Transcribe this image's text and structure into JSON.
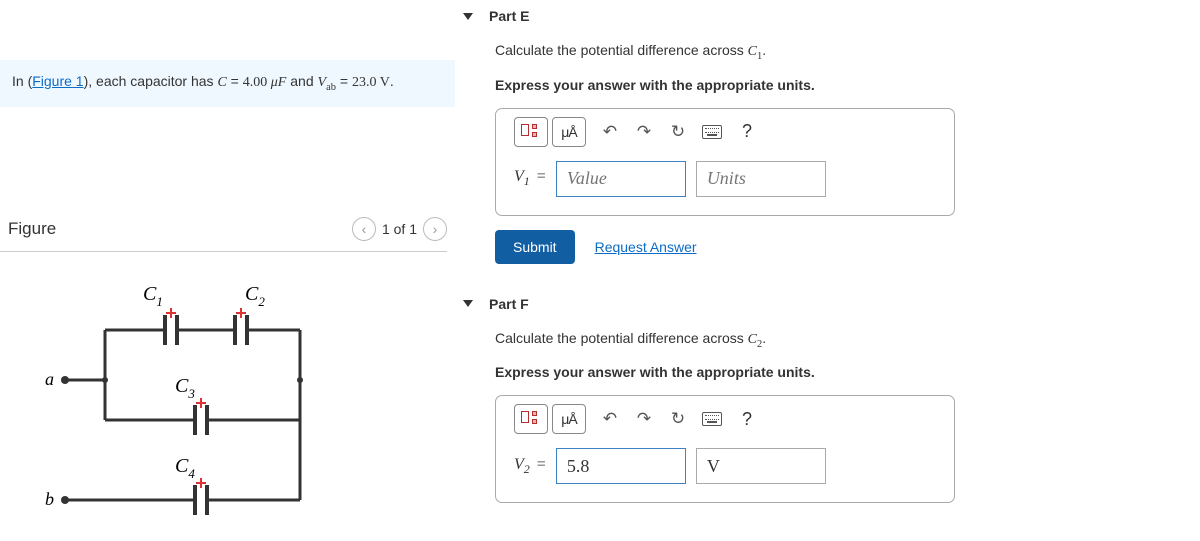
{
  "context": {
    "prefix": "In (",
    "figlink": "Figure 1",
    "mid": "), each capacitor has ",
    "eq1_lhs": "C",
    "eq1_eq": " = ",
    "eq1_val": "4.00 ",
    "eq1_unit": "μF",
    "and": " and ",
    "eq2_lhs_v": "V",
    "eq2_lhs_sub": "ab",
    "eq2_eq": " = ",
    "eq2_val": "23.0 V",
    "period": "."
  },
  "figure": {
    "title": "Figure",
    "pager": "1 of 1",
    "labels": {
      "a": "a",
      "b": "b",
      "c1a": "C",
      "c1b": "1",
      "c2a": "C",
      "c2b": "2",
      "c3a": "C",
      "c3b": "3",
      "c4a": "C",
      "c4b": "4"
    }
  },
  "parts": {
    "e": {
      "label": "Part E",
      "q": "Calculate the potential difference across ",
      "qsymA": "C",
      "qsymB": "1",
      "qend": ".",
      "instr": "Express your answer with the appropriate units.",
      "ua": "μÅ",
      "var": "V",
      "varsub": "1",
      "eq": " =",
      "value_ph": "Value",
      "units_ph": "Units",
      "submit": "Submit",
      "request": "Request Answer",
      "qmark": "?"
    },
    "f": {
      "label": "Part F",
      "q": "Calculate the potential difference across ",
      "qsymA": "C",
      "qsymB": "2",
      "qend": ".",
      "instr": "Express your answer with the appropriate units.",
      "ua": "μÅ",
      "var": "V",
      "varsub": "2",
      "eq": " =",
      "value": "5.8",
      "units": "V",
      "qmark": "?"
    }
  }
}
